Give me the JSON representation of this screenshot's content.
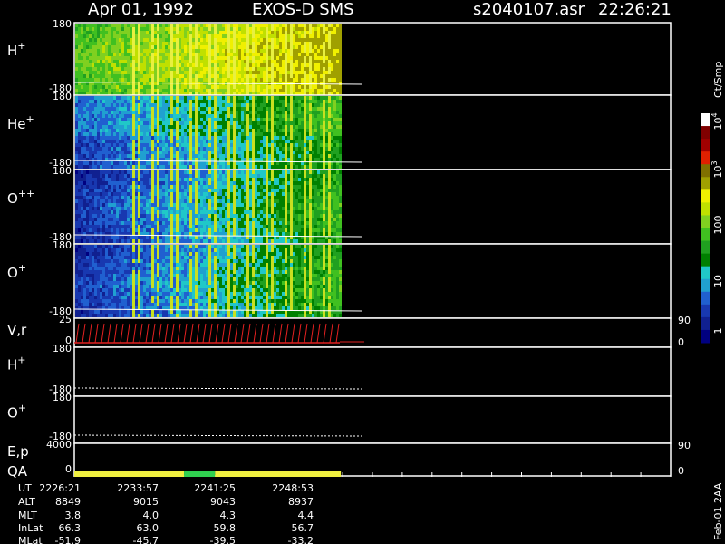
{
  "header": {
    "date": "Apr 01, 1992",
    "instrument": "EXOS-D SMS",
    "file": "s2040107.asr",
    "time": "22:26:21"
  },
  "colorbar": {
    "unit": "Ct/Smp",
    "ticks": [
      "1",
      "10",
      "100",
      "10",
      "10"
    ],
    "tick_exponents": [
      "",
      "",
      "",
      "3",
      "4"
    ],
    "colors": [
      "#000080",
      "#102090",
      "#1838b0",
      "#2060d0",
      "#20a0d0",
      "#20c8c8",
      "#008000",
      "#20a020",
      "#40c020",
      "#80d020",
      "#c0e000",
      "#f0f000",
      "#a0a000",
      "#807000",
      "#e02000",
      "#a00000",
      "#800000",
      "#ffffff"
    ]
  },
  "panels": [
    {
      "key": "hplus",
      "label": "H",
      "sup": "+",
      "ymax": "180",
      "ymin": "-180"
    },
    {
      "key": "heplus",
      "label": "He",
      "sup": "+",
      "ymax": "180",
      "ymin": "-180"
    },
    {
      "key": "oplusplus",
      "label": "O",
      "sup": "++",
      "ymax": "180",
      "ymin": "-180"
    },
    {
      "key": "oplus",
      "label": "O",
      "sup": "+",
      "ymax": "180",
      "ymin": "-180"
    },
    {
      "key": "vr",
      "label": "V,r",
      "sup": "",
      "ymax": "25",
      "ymin": "0",
      "rmax": "90",
      "rmin": "0"
    },
    {
      "key": "hplus2",
      "label": "H",
      "sup": "+",
      "ymax": "180",
      "ymin": "-180"
    },
    {
      "key": "oplus2",
      "label": "O",
      "sup": "+",
      "ymax": "180",
      "ymin": "-180"
    },
    {
      "key": "ep",
      "label": "E,p",
      "label2": "QA",
      "sup": "",
      "ymax": "4000",
      "ymin": "0",
      "rmax": "90",
      "rmin": "0"
    }
  ],
  "table": {
    "row_labels": [
      "UT",
      "ALT",
      "MLT",
      "InLat",
      "MLat"
    ],
    "columns": [
      [
        "2226:21",
        "8849",
        "3.8",
        "66.3",
        "-51.9"
      ],
      [
        "2233:57",
        "9015",
        "4.0",
        "63.0",
        "-45.7"
      ],
      [
        "2241:25",
        "9043",
        "4.3",
        "59.8",
        "-39.5"
      ],
      [
        "2248:53",
        "8937",
        "4.4",
        "56.7",
        "-33.2"
      ]
    ]
  },
  "footer_vertical": "Feb-01 2AA",
  "chart_data": {
    "type": "heatmap",
    "title": "Apr 01, 1992   EXOS-D SMS",
    "x_ticks": [
      "2226:21",
      "2233:57",
      "2241:25",
      "2248:53"
    ],
    "data_extent_fraction": 0.447,
    "series": [
      {
        "panel": "H+",
        "ylim": [
          -180,
          180
        ]
      },
      {
        "panel": "He+",
        "ylim": [
          -180,
          180
        ]
      },
      {
        "panel": "O++",
        "ylim": [
          -180,
          180
        ]
      },
      {
        "panel": "O+",
        "ylim": [
          -180,
          180
        ]
      },
      {
        "panel": "V,r",
        "ylim": [
          0,
          25
        ],
        "rlim": [
          0,
          90
        ]
      },
      {
        "panel": "H+",
        "ylim": [
          -180,
          180
        ]
      },
      {
        "panel": "O+",
        "ylim": [
          -180,
          180
        ]
      },
      {
        "panel": "E,p",
        "ylim": [
          0,
          4000
        ],
        "rlim": [
          0,
          90
        ]
      }
    ],
    "qa_bar": [
      {
        "from": 0.0,
        "to": 0.184,
        "color": "#f0f040"
      },
      {
        "from": 0.184,
        "to": 0.236,
        "color": "#30d050"
      },
      {
        "from": 0.236,
        "to": 0.447,
        "color": "#f0f040"
      }
    ]
  }
}
